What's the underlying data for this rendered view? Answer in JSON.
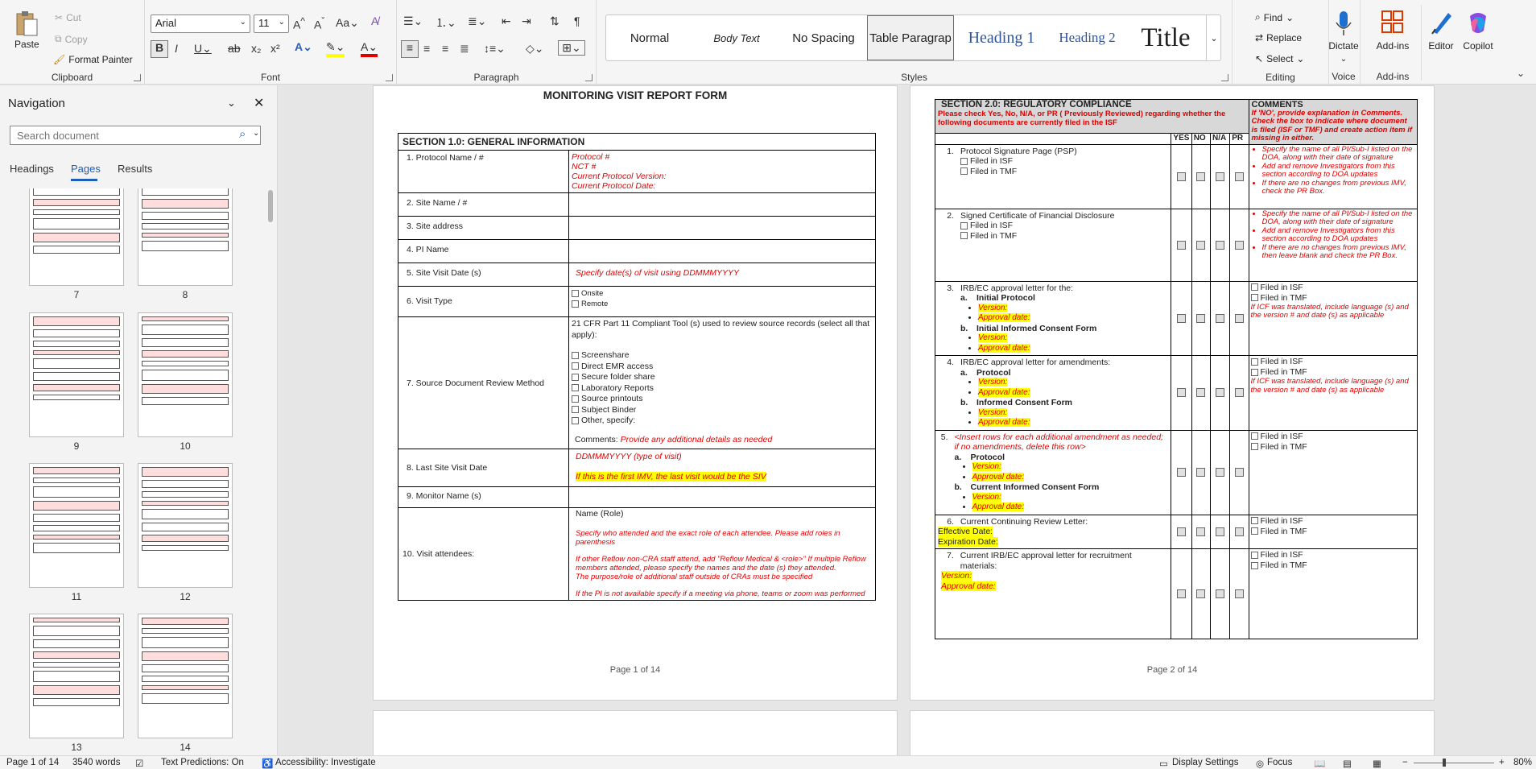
{
  "ribbon": {
    "clipboard": {
      "paste": "Paste",
      "cut": "Cut",
      "copy": "Copy",
      "format_painter": "Format Painter",
      "label": "Clipboard"
    },
    "font": {
      "name": "Arial",
      "size": "11",
      "label": "Font",
      "bold": "B",
      "italic": "I",
      "underline": "U",
      "strike": "ab",
      "sub": "x₂",
      "sup": "x²"
    },
    "paragraph": {
      "label": "Paragraph"
    },
    "styles": {
      "label": "Styles",
      "items": [
        "Normal",
        "Body Text",
        "No Spacing",
        "Table Paragrap",
        "Heading 1",
        "Heading 2",
        "Title"
      ]
    },
    "editing": {
      "find": "Find",
      "replace": "Replace",
      "select": "Select",
      "label": "Editing"
    },
    "voice": {
      "dictate": "Dictate",
      "label": "Voice"
    },
    "addins": {
      "addins": "Add-ins",
      "label": "Add-ins"
    },
    "editor": "Editor",
    "copilot": "Copilot"
  },
  "nav": {
    "title": "Navigation",
    "search_placeholder": "Search document",
    "tabs": [
      "Headings",
      "Pages",
      "Results"
    ],
    "page_numbers": [
      "7",
      "8",
      "9",
      "10",
      "11",
      "12",
      "13",
      "14"
    ]
  },
  "page1": {
    "title": "MONITORING VISIT REPORT FORM",
    "section": "SECTION 1.0: GENERAL INFORMATION",
    "rows": [
      {
        "label": "1.  Protocol Name / #",
        "lines": [
          "Protocol #",
          "NCT #",
          "Current Protocol Version:",
          "Current Protocol Date:"
        ]
      },
      {
        "label": "2.  Site Name / #"
      },
      {
        "label": "3.  Site address"
      },
      {
        "label": "4.  PI Name"
      },
      {
        "label": "5.  Site Visit Date (s)",
        "lines": [
          "Specify date(s) of visit using DDMMMYYYY"
        ]
      },
      {
        "label": "6.  Visit Type",
        "lines": [
          "Onsite",
          "Remote"
        ]
      },
      {
        "label": "7.  Source Document Review Method",
        "intro": "21 CFR Part 11 Compliant Tool (s) used to review source records (select all that apply):",
        "opts": [
          "Screenshare",
          "Direct EMR access",
          "Secure folder share",
          "Laboratory Reports",
          "Source printouts",
          "Subject Binder",
          "Other, specify:"
        ],
        "comments_label": "Comments:",
        "comments": "Provide any additional details as needed"
      },
      {
        "label": "8.  Last Site Visit Date",
        "lines": [
          "DDMMMYYYY (type of visit)",
          "If this is the first IMV, the last visit would be the SIV"
        ]
      },
      {
        "label": "9.  Monitor Name (s)"
      },
      {
        "label": "10.  Visit attendees:",
        "name_role": "Name (Role)",
        "lines": [
          "Specify who attended and the exact role of each attendee. Please add roles in parenthesis",
          "If other Reflow non-CRA staff attend, add \"Reflow Medical & <role>\" If multiple Reflow members attended, please specify the names and the date (s) they attended.",
          "The purpose/role of additional staff outside of CRAs must be specified",
          "If the PI is not available specify if a meeting via phone, teams or zoom was performed"
        ]
      }
    ],
    "footer": "Page 1 of 14"
  },
  "page2": {
    "section": "SECTION 2.0: REGULATORY COMPLIANCE",
    "instruction": "Please check Yes, No, N/A, or PR  ( Previously Reviewed) regarding whether the following documents are currently filed in the ISF",
    "comments_head": "COMMENTS",
    "comments_instr": "If 'NO', provide explanation in Comments. Check the box to indicate where document is filed (ISF or TMF) and create action item if missing in either.",
    "cols": [
      "YES",
      "NO",
      "N/A",
      "PR"
    ],
    "items": [
      {
        "n": "1.",
        "text": "Protocol Signature Page (PSP)",
        "sub": [
          "Filed in ISF",
          "Filed in TMF"
        ],
        "comments": [
          "Specify the name of all PI/Sub-I listed on the DOA, along with their date of signature",
          "Add and remove Investigators from this section according to DOA updates",
          "If there are no changes from previous IMV, check the PR Box."
        ]
      },
      {
        "n": "2.",
        "text": "Signed Certificate of Financial Disclosure",
        "sub": [
          "Filed in ISF",
          "Filed in TMF"
        ],
        "comments": [
          "Specify the name of all PI/Sub-I listed on the DOA, along with their date of signature",
          "Add and remove Investigators from this section according to DOA updates",
          "If there are no changes from previous IMV, then leave blank and check the PR Box."
        ]
      },
      {
        "n": "3.",
        "text": "IRB/EC approval letter for the:",
        "a": "Initial Protocol",
        "b": "Initial Informed Consent Form",
        "v": "Version:",
        "d": "Approval date:",
        "files": [
          "Filed in ISF",
          "Filed in TMF"
        ],
        "note": "If ICF was translated, include language (s) and the version # and date (s) as applicable"
      },
      {
        "n": "4.",
        "text": "IRB/EC approval letter for amendments:",
        "a": "Protocol",
        "b": "Informed Consent Form",
        "v": "Version:",
        "d": "Approval date:",
        "files": [
          "Filed in ISF",
          "Filed in TMF"
        ],
        "note": "If ICF was translated, include language (s) and the version # and date (s) as applicable"
      },
      {
        "n": "5.",
        "text": "<Insert rows for each additional amendment as needed; if no amendments, delete this row>",
        "a": "Protocol",
        "b": "Current Informed Consent Form",
        "v": "Version:",
        "d": "Approval date:",
        "files": [
          "Filed in ISF",
          "Filed in TMF"
        ]
      },
      {
        "n": "6.",
        "text": "Current Continuing Review Letter:",
        "e": "Effective Date:",
        "x": "Expiration Date:",
        "files": [
          "Filed in ISF",
          "Filed in TMF"
        ]
      },
      {
        "n": "7.",
        "text": "Current IRB/EC approval letter for recruitment materials:",
        "v": "Version:",
        "d": "Approval date:",
        "files": [
          "Filed in ISF",
          "Filed in TMF"
        ]
      }
    ],
    "footer": "Page 2 of 14"
  },
  "status": {
    "page": "Page 1 of 14",
    "words": "3540 words",
    "predictions": "Text Predictions: On",
    "accessibility": "Accessibility: Investigate",
    "display": "Display Settings",
    "focus": "Focus",
    "zoom": "80%"
  }
}
